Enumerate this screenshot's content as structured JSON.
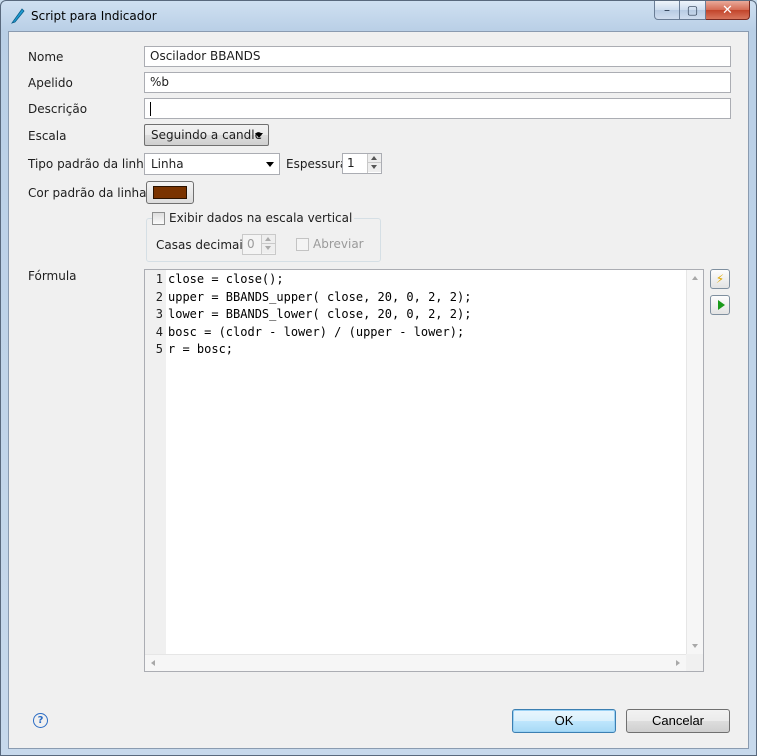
{
  "window": {
    "title": "Script para Indicador",
    "app_icon": "quill-icon",
    "close_glyph": "✕",
    "max_glyph": "▢",
    "min_glyph": "–"
  },
  "form": {
    "nome_label": "Nome",
    "nome_value": "Oscilador BBANDS",
    "apelido_label": "Apelido",
    "apelido_value": "%b",
    "descricao_label": "Descrição",
    "descricao_value": "",
    "escala_label": "Escala",
    "escala_value": "Seguindo a candle",
    "tipo_label": "Tipo padrão da linha",
    "tipo_value": "Linha",
    "espessura_label": "Espessura",
    "espessura_value": "1",
    "cor_label": "Cor padrão da linha",
    "cor_value": "#7a3300",
    "exibir_label": "Exibir dados na escala vertical",
    "exibir_checked": false,
    "casas_label": "Casas decimais",
    "casas_value": "0",
    "abreviar_label": "Abreviar",
    "abreviar_checked": false,
    "formula_label": "Fórmula"
  },
  "editor": {
    "lines": [
      {
        "num": "1",
        "code": "close = close();"
      },
      {
        "num": "2",
        "code": "upper = BBANDS_upper( close, 20, 0, 2, 2);"
      },
      {
        "num": "3",
        "code": "lower = BBANDS_lower( close, 20, 0, 2, 2);"
      },
      {
        "num": "4",
        "code": "bosc = (clodr - lower) / (upper - lower);"
      },
      {
        "num": "5",
        "code": "r = bosc;"
      }
    ]
  },
  "side_buttons": {
    "lightning": "lightning-icon",
    "run": "play-icon",
    "bolt_glyph": "⚡"
  },
  "footer": {
    "help_glyph": "?",
    "ok_label": "OK",
    "cancel_label": "Cancelar"
  }
}
